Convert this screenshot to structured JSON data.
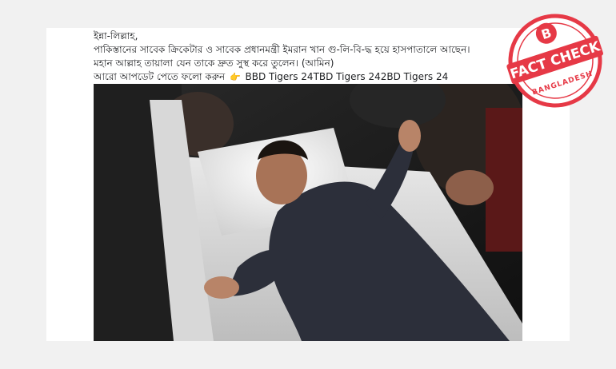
{
  "post": {
    "line1": "ইন্না-লিল্লাহ,",
    "line2": "পাকিস্তানের সাবেক ক্রিকেটার ও সাবেক প্রধানমন্ত্রী ইমরান খান গু-লি-বি-দ্ধ হয়ে হাসপাতালে আছেন।",
    "line3": "মহান আল্লাহ তায়ালা যেন তাকে দ্রুত সুস্থ করে তুলেন। (আমিন)",
    "line4_prefix": "আরো আপডেট পেতে ফলো করুন",
    "line4_suffix": "BBD Tigers 24TBD Tigers 242BD Tigers 24"
  },
  "stamp": {
    "letter": "B",
    "title": "FACT CHECK",
    "subtitle": "BANGLADESH",
    "color": "#e63946"
  },
  "photo": {
    "alt": "photo"
  }
}
